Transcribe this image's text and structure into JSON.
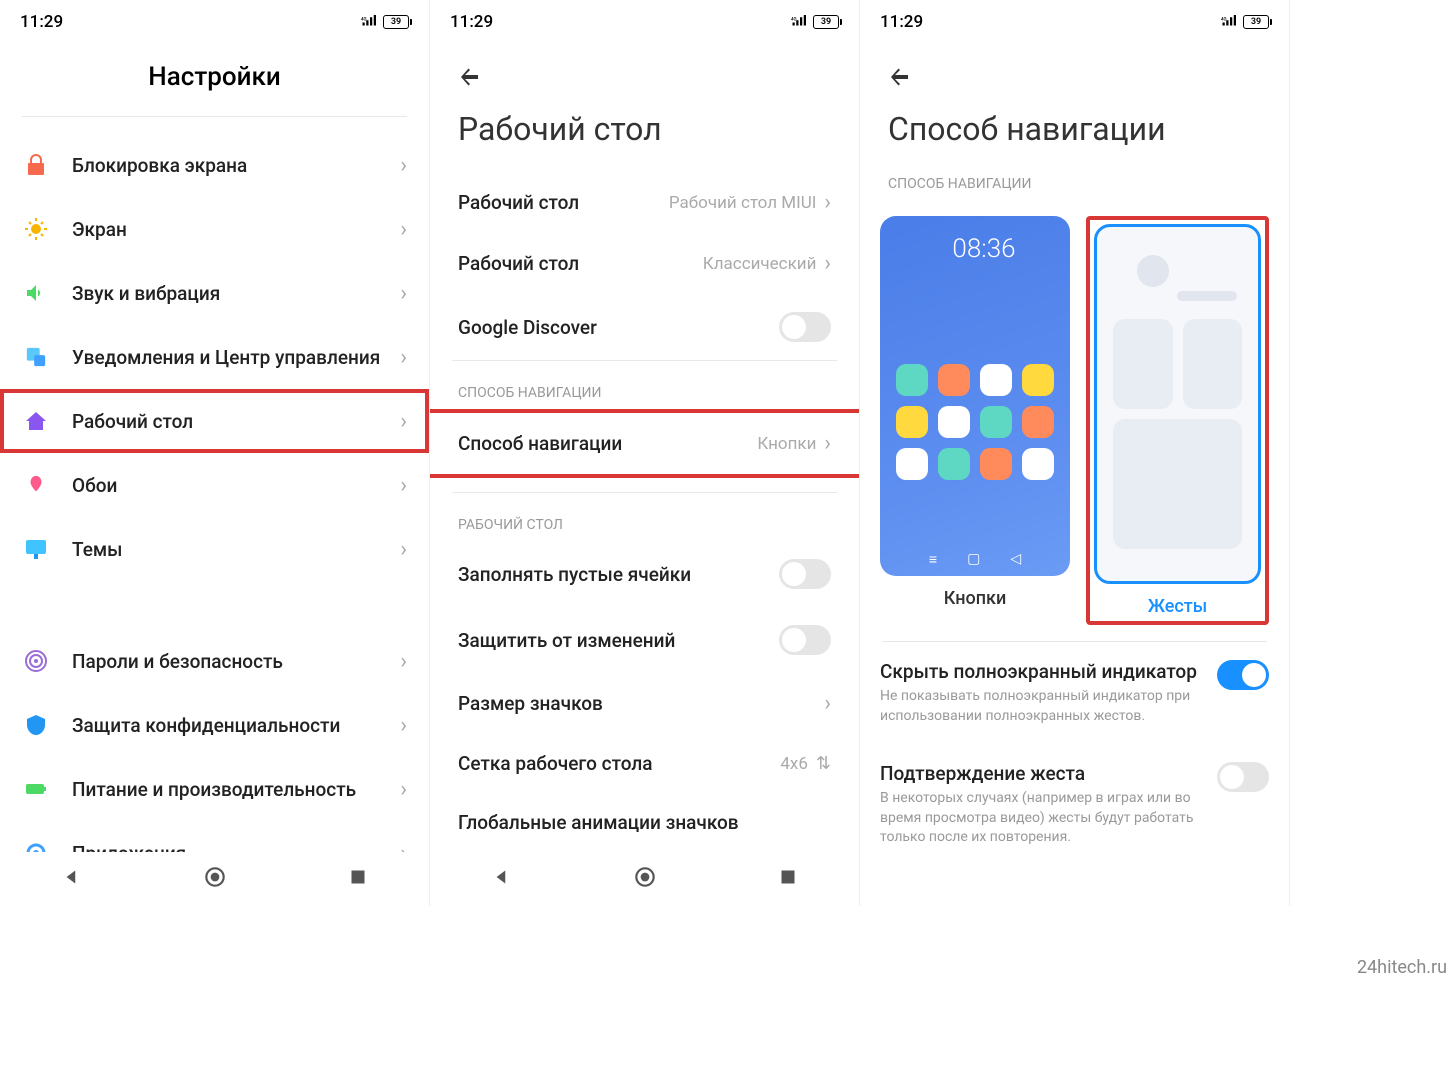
{
  "status": {
    "time": "11:29",
    "battery": "39",
    "signal": "4G"
  },
  "screen1": {
    "title": "Настройки",
    "items": [
      {
        "label": "Блокировка экрана",
        "icon": "lock",
        "color": "#f56a4d"
      },
      {
        "label": "Экран",
        "icon": "sun",
        "color": "#f7b500"
      },
      {
        "label": "Звук и вибрация",
        "icon": "speaker",
        "color": "#4cd964"
      },
      {
        "label": "Уведомления и Центр управления",
        "icon": "notif",
        "color": "#5ac8fa"
      },
      {
        "label": "Рабочий стол",
        "icon": "home",
        "color": "#8a56f0",
        "highlighted": true
      },
      {
        "label": "Обои",
        "icon": "wallpaper",
        "color": "#ff5a8c"
      },
      {
        "label": "Темы",
        "icon": "themes",
        "color": "#40c4ff"
      }
    ],
    "items2": [
      {
        "label": "Пароли и безопасность",
        "icon": "fingerprint",
        "color": "#9b6dd7"
      },
      {
        "label": "Защита конфиденциальности",
        "icon": "shield",
        "color": "#2196f3"
      },
      {
        "label": "Питание и производительность",
        "icon": "battery",
        "color": "#4cd964"
      },
      {
        "label": "Приложения",
        "icon": "apps",
        "color": "#40a0ff"
      }
    ]
  },
  "screen2": {
    "title": "Рабочий стол",
    "prefs1": [
      {
        "label": "Рабочий стол",
        "value": "Рабочий стол MIUI"
      },
      {
        "label": "Рабочий стол",
        "value": "Классический"
      },
      {
        "label": "Google Discover",
        "toggle": "off"
      }
    ],
    "section_nav": "СПОСОБ НАВИГАЦИИ",
    "nav_item": {
      "label": "Способ навигации",
      "value": "Кнопки",
      "highlighted": true
    },
    "section_desktop": "РАБОЧИЙ СТОЛ",
    "prefs2": [
      {
        "label": "Заполнять пустые ячейки",
        "toggle": "off"
      },
      {
        "label": "Защитить от изменений",
        "toggle": "off"
      },
      {
        "label": "Размер значков"
      },
      {
        "label": "Сетка рабочего стола",
        "value": "4x6",
        "updown": true
      },
      {
        "label": "Глобальные анимации значков"
      }
    ]
  },
  "screen3": {
    "title": "Способ навигации",
    "section": "СПОСОБ НАВИГАЦИИ",
    "options": {
      "buttons_label": "Кнопки",
      "gestures_label": "Жесты",
      "preview_time": "08:36"
    },
    "settings": [
      {
        "title": "Скрыть полноэкранный индикатор",
        "desc": "Не показывать полноэкранный индикатор при использовании полноэкранных жестов.",
        "toggle": "on"
      },
      {
        "title": "Подтверждение жеста",
        "desc": "В некоторых случаях (например в играх или во время просмотра видео) жесты будут работать только после их повторения.",
        "toggle": "off"
      }
    ]
  },
  "watermark": "24hitech.ru"
}
